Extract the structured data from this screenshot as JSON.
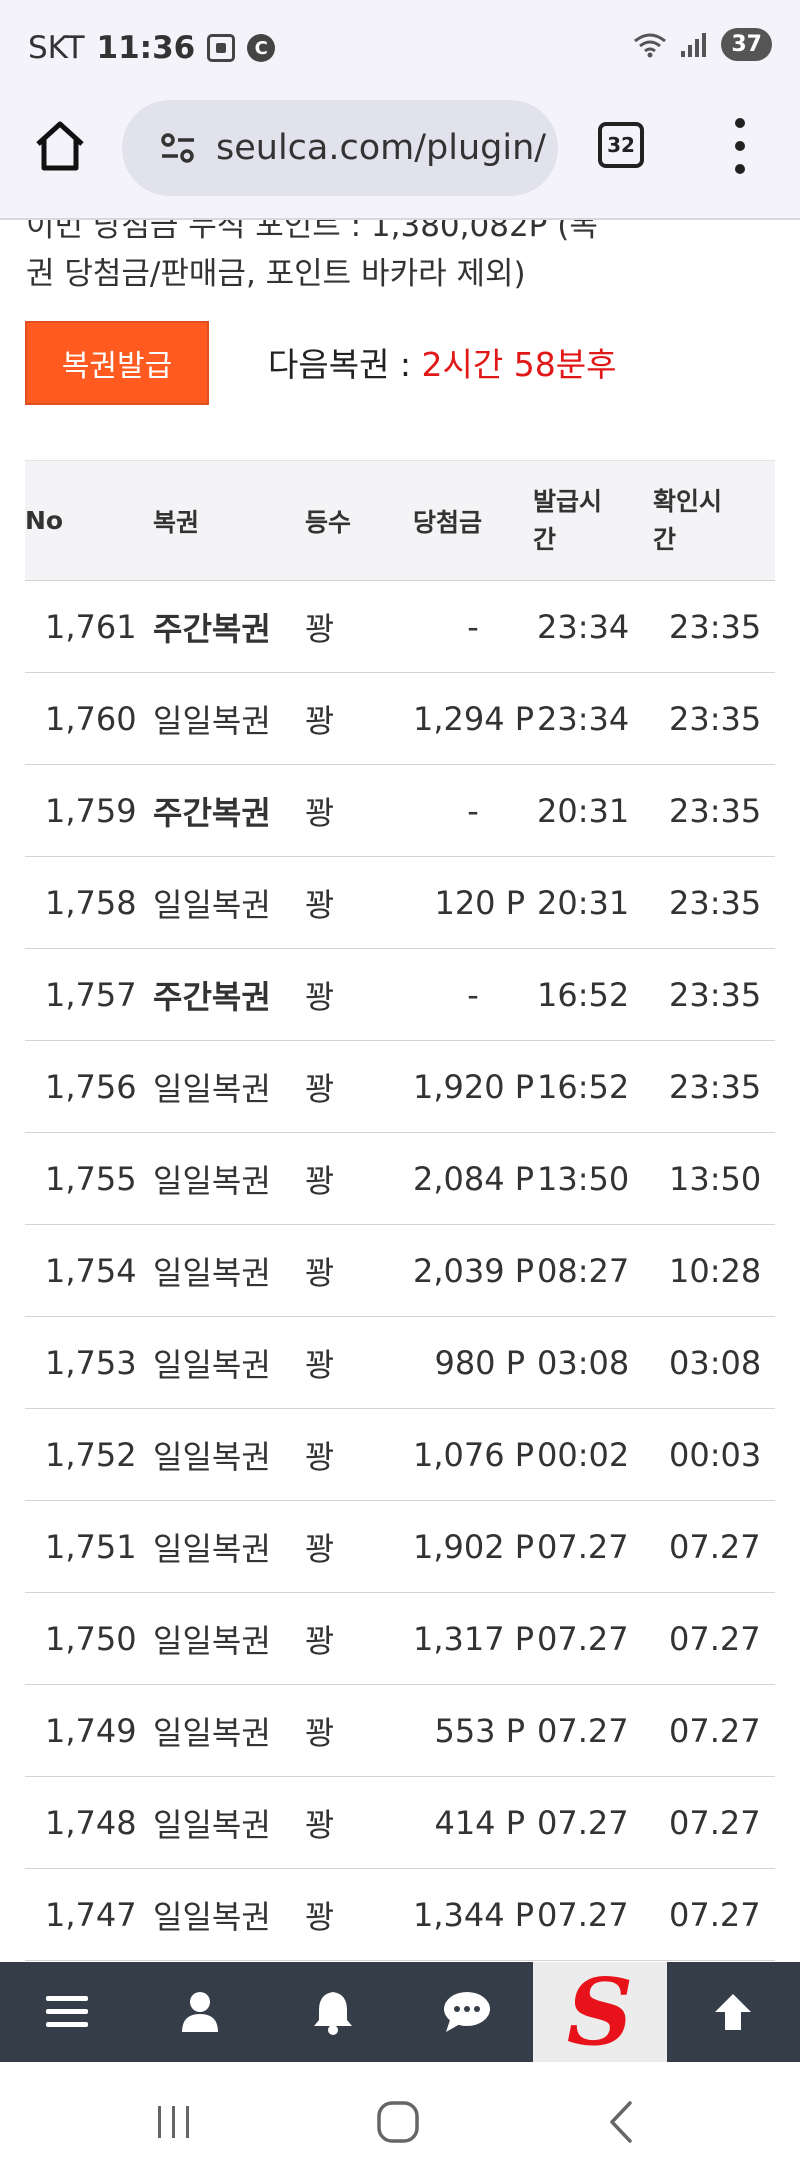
{
  "status_bar": {
    "carrier": "SKT",
    "time": "11:36",
    "battery": "37"
  },
  "browser": {
    "url": "seulca.com/plugin/",
    "tab_count": "32"
  },
  "page": {
    "clipped_text": "이번 당첨금 누적 포인트 : 1,380,082P (복",
    "notice_line": "권 당첨금/판매금, 포인트 바카라 제외)",
    "issue_button": "복권발급",
    "next_label": "다음복권 : ",
    "next_remaining": "2시간 58분후"
  },
  "table": {
    "headers": {
      "no": "No",
      "type": "복권",
      "rank": "등수",
      "prize": "당첨금",
      "issue_time_1": "발급시",
      "issue_time_2": "간",
      "check_time_1": "확인시",
      "check_time_2": "간"
    },
    "rows": [
      {
        "no": "1,761",
        "type": "주간복권",
        "weekly": true,
        "rank": "꽝",
        "prize": "-",
        "issued": "23:34",
        "checked": "23:35"
      },
      {
        "no": "1,760",
        "type": "일일복권",
        "weekly": false,
        "rank": "꽝",
        "prize": "1,294 P",
        "issued": "23:34",
        "checked": "23:35"
      },
      {
        "no": "1,759",
        "type": "주간복권",
        "weekly": true,
        "rank": "꽝",
        "prize": "-",
        "issued": "20:31",
        "checked": "23:35"
      },
      {
        "no": "1,758",
        "type": "일일복권",
        "weekly": false,
        "rank": "꽝",
        "prize": "120 P",
        "issued": "20:31",
        "checked": "23:35"
      },
      {
        "no": "1,757",
        "type": "주간복권",
        "weekly": true,
        "rank": "꽝",
        "prize": "-",
        "issued": "16:52",
        "checked": "23:35"
      },
      {
        "no": "1,756",
        "type": "일일복권",
        "weekly": false,
        "rank": "꽝",
        "prize": "1,920 P",
        "issued": "16:52",
        "checked": "23:35"
      },
      {
        "no": "1,755",
        "type": "일일복권",
        "weekly": false,
        "rank": "꽝",
        "prize": "2,084 P",
        "issued": "13:50",
        "checked": "13:50"
      },
      {
        "no": "1,754",
        "type": "일일복권",
        "weekly": false,
        "rank": "꽝",
        "prize": "2,039 P",
        "issued": "08:27",
        "checked": "10:28"
      },
      {
        "no": "1,753",
        "type": "일일복권",
        "weekly": false,
        "rank": "꽝",
        "prize": "980 P",
        "issued": "03:08",
        "checked": "03:08"
      },
      {
        "no": "1,752",
        "type": "일일복권",
        "weekly": false,
        "rank": "꽝",
        "prize": "1,076 P",
        "issued": "00:02",
        "checked": "00:03"
      },
      {
        "no": "1,751",
        "type": "일일복권",
        "weekly": false,
        "rank": "꽝",
        "prize": "1,902 P",
        "issued": "07.27",
        "checked": "07.27"
      },
      {
        "no": "1,750",
        "type": "일일복권",
        "weekly": false,
        "rank": "꽝",
        "prize": "1,317 P",
        "issued": "07.27",
        "checked": "07.27"
      },
      {
        "no": "1,749",
        "type": "일일복권",
        "weekly": false,
        "rank": "꽝",
        "prize": "553 P",
        "issued": "07.27",
        "checked": "07.27"
      },
      {
        "no": "1,748",
        "type": "일일복권",
        "weekly": false,
        "rank": "꽝",
        "prize": "414 P",
        "issued": "07.27",
        "checked": "07.27"
      },
      {
        "no": "1,747",
        "type": "일일복권",
        "weekly": false,
        "rank": "꽝",
        "prize": "1,344 P",
        "issued": "07.27",
        "checked": "07.27"
      }
    ]
  },
  "bottom_nav": {
    "items": [
      "menu-icon",
      "user-icon",
      "bell-icon",
      "chat-icon",
      "site-logo",
      "arrow-up-icon"
    ],
    "logo_letter": "S"
  },
  "colors": {
    "accent": "#ff5a1f",
    "remaining_text": "#e01818",
    "nav_bg": "#343d48",
    "logo_red": "#e8131a"
  }
}
